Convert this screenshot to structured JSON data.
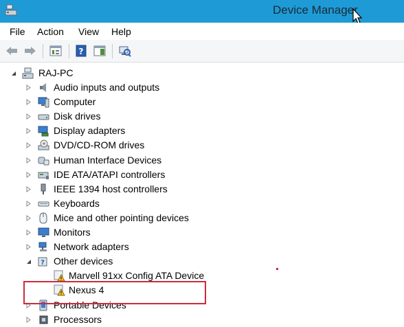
{
  "window": {
    "title": "Device Manager"
  },
  "menu": [
    "File",
    "Action",
    "View",
    "Help"
  ],
  "toolbar": {
    "buttons": [
      "back",
      "forward",
      "properties-list",
      "help",
      "show-hide",
      "scan-hardware"
    ]
  },
  "tree": {
    "root": "RAJ-PC",
    "categories": [
      {
        "label": "Audio inputs and outputs",
        "icon": "speaker-icon"
      },
      {
        "label": "Computer",
        "icon": "computer-icon"
      },
      {
        "label": "Disk drives",
        "icon": "disk-drive-icon"
      },
      {
        "label": "Display adapters",
        "icon": "display-adapter-icon"
      },
      {
        "label": "DVD/CD-ROM drives",
        "icon": "dvd-drive-icon"
      },
      {
        "label": "Human Interface Devices",
        "icon": "hid-icon"
      },
      {
        "label": "IDE ATA/ATAPI controllers",
        "icon": "ide-controller-icon"
      },
      {
        "label": "IEEE 1394 host controllers",
        "icon": "firewire-icon"
      },
      {
        "label": "Keyboards",
        "icon": "keyboard-icon"
      },
      {
        "label": "Mice and other pointing devices",
        "icon": "mouse-icon"
      },
      {
        "label": "Monitors",
        "icon": "monitor-icon"
      },
      {
        "label": "Network adapters",
        "icon": "network-adapter-icon"
      },
      {
        "label": "Other devices",
        "icon": "other-devices-icon",
        "expanded": true,
        "children": [
          "Marvell 91xx Config ATA Device",
          "Nexus 4"
        ]
      },
      {
        "label": "Portable Devices",
        "icon": "portable-devices-icon"
      },
      {
        "label": "Processors",
        "icon": "processor-icon"
      }
    ]
  },
  "colors": {
    "titlebar": "#1e9bd6",
    "highlight": "#cc2b3b",
    "warning": "#f2c32c"
  }
}
